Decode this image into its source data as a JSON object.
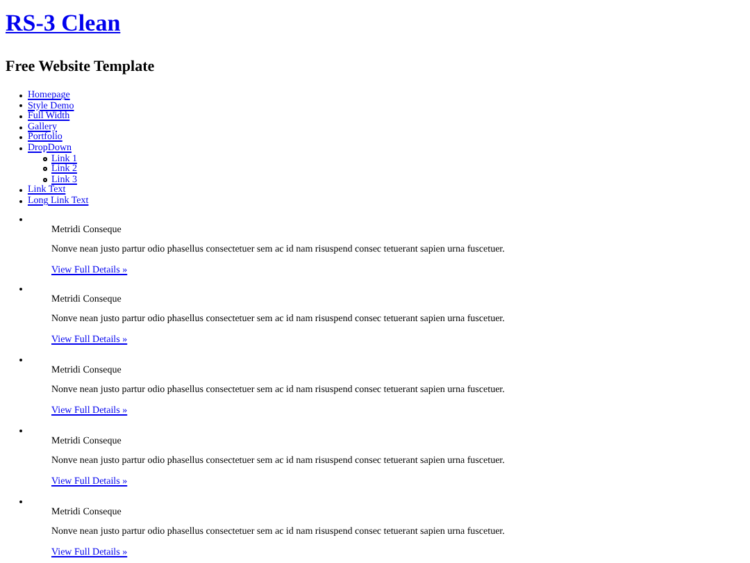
{
  "site_title": "RS-3 Clean",
  "tagline": "Free Website Template",
  "nav": [
    {
      "label": "Homepage"
    },
    {
      "label": "Style Demo"
    },
    {
      "label": "Full Width"
    },
    {
      "label": "Gallery"
    },
    {
      "label": "Portfolio"
    },
    {
      "label": "DropDown",
      "children": [
        {
          "label": "Link 1"
        },
        {
          "label": "Link 2"
        },
        {
          "label": "Link 3"
        }
      ]
    },
    {
      "label": "Link Text"
    },
    {
      "label": "Long Link Text"
    }
  ],
  "products": [
    {
      "name": "Metridi Conseque",
      "description": "Nonve nean justo partur odio phasellus consectetuer sem ac id nam risuspend consec tetuerant sapien urna fuscetuer.",
      "link": "View Full Details »"
    },
    {
      "name": "Metridi Conseque",
      "description": "Nonve nean justo partur odio phasellus consectetuer sem ac id nam risuspend consec tetuerant sapien urna fuscetuer.",
      "link": "View Full Details »"
    },
    {
      "name": "Metridi Conseque",
      "description": "Nonve nean justo partur odio phasellus consectetuer sem ac id nam risuspend consec tetuerant sapien urna fuscetuer.",
      "link": "View Full Details »"
    },
    {
      "name": "Metridi Conseque",
      "description": "Nonve nean justo partur odio phasellus consectetuer sem ac id nam risuspend consec tetuerant sapien urna fuscetuer.",
      "link": "View Full Details »"
    },
    {
      "name": "Metridi Conseque",
      "description": "Nonve nean justo partur odio phasellus consectetuer sem ac id nam risuspend consec tetuerant sapien urna fuscetuer.",
      "link": "View Full Details »"
    }
  ]
}
